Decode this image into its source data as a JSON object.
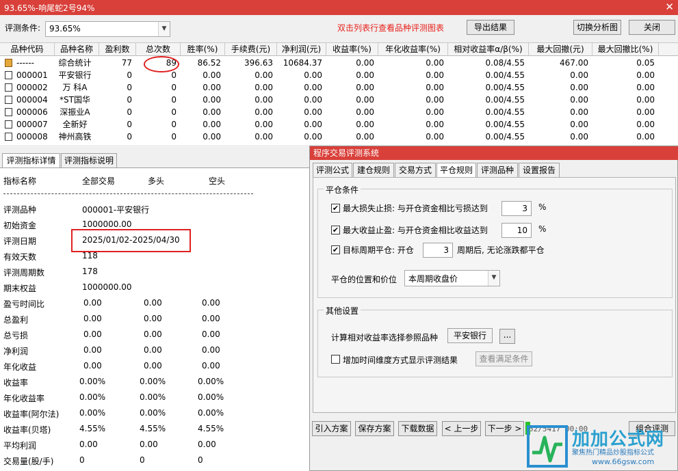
{
  "window": {
    "title": "93.65%-响尾蛇2号94%"
  },
  "toolbar": {
    "cond_label": "评测条件:",
    "cond_value": "93.65%",
    "hint": "双击列表行查看品种评测图表",
    "export_label": "导出结果",
    "switch_label": "切换分析图",
    "close_label": "关闭"
  },
  "grid": {
    "headers": [
      "品种代码",
      "品种名称",
      "盈利数",
      "总次数",
      "胜率(%)",
      "手续费(元)",
      "净利润(元)",
      "收益率(%)",
      "年化收益率(%)",
      "相对收益率α/β(%)",
      "最大回撤(元)",
      "最大回撤比(%)"
    ],
    "rows": [
      [
        "------",
        "综合统计",
        "77",
        "89",
        "86.52",
        "396.63",
        "10684.37",
        "0.00",
        "0.00",
        "0.08/4.55",
        "467.00",
        "0.05"
      ],
      [
        "000001",
        "平安银行",
        "0",
        "0",
        "0.00",
        "0.00",
        "0.00",
        "0.00",
        "0.00",
        "0.00/4.55",
        "0.00",
        "0.00"
      ],
      [
        "000002",
        "万 科A",
        "0",
        "0",
        "0.00",
        "0.00",
        "0.00",
        "0.00",
        "0.00",
        "0.00/4.55",
        "0.00",
        "0.00"
      ],
      [
        "000004",
        "*ST国华",
        "0",
        "0",
        "0.00",
        "0.00",
        "0.00",
        "0.00",
        "0.00",
        "0.00/4.55",
        "0.00",
        "0.00"
      ],
      [
        "000006",
        "深振业A",
        "0",
        "0",
        "0.00",
        "0.00",
        "0.00",
        "0.00",
        "0.00",
        "0.00/4.55",
        "0.00",
        "0.00"
      ],
      [
        "000007",
        "全新好",
        "0",
        "0",
        "0.00",
        "0.00",
        "0.00",
        "0.00",
        "0.00",
        "0.00/4.55",
        "0.00",
        "0.00"
      ],
      [
        "000008",
        "神州高铁",
        "0",
        "0",
        "0.00",
        "0.00",
        "0.00",
        "0.00",
        "0.00",
        "0.00/4.55",
        "0.00",
        "0.00"
      ]
    ]
  },
  "left": {
    "tabs": [
      "评测指标详情",
      "评测指标说明"
    ],
    "headers": [
      "指标名称",
      "全部交易",
      "多头",
      "空头"
    ],
    "rows": [
      {
        "k": "评测品种",
        "v": [
          "000001-平安银行"
        ]
      },
      {
        "k": "初始资金",
        "v": [
          "1000000.00"
        ]
      },
      {
        "k": "评测日期",
        "v": [
          "2025/01/02-2025/04/30"
        ]
      },
      {
        "k": "有效天数",
        "v": [
          "118"
        ]
      },
      {
        "k": "评测周期数",
        "v": [
          "178"
        ]
      },
      {
        "k": "期末权益",
        "v": [
          "1000000.00"
        ]
      },
      {
        "k": "盈亏时间比",
        "v": [
          "0.00",
          "0.00",
          "0.00"
        ]
      },
      {
        "k": "总盈利",
        "v": [
          "0.00",
          "0.00",
          "0.00"
        ]
      },
      {
        "k": "总亏损",
        "v": [
          "0.00",
          "0.00",
          "0.00"
        ]
      },
      {
        "k": "净利润",
        "v": [
          "0.00",
          "0.00",
          "0.00"
        ]
      },
      {
        "k": "年化收益",
        "v": [
          "0.00",
          "0.00",
          "0.00"
        ]
      },
      {
        "k": "收益率",
        "v": [
          "0.00%",
          "0.00%",
          "0.00%"
        ]
      },
      {
        "k": "年化收益率",
        "v": [
          "0.00%",
          "0.00%",
          "0.00%"
        ]
      },
      {
        "k": "收益率(阿尔法)",
        "v": [
          "0.00%",
          "0.00%",
          "0.00%"
        ]
      },
      {
        "k": "收益率(贝塔)",
        "v": [
          "4.55%",
          "4.55%",
          "4.55%"
        ]
      },
      {
        "k": "平均利润",
        "v": [
          "0.00",
          "0.00",
          "0.00"
        ]
      },
      {
        "k": "交易量(股/手)",
        "v": [
          "0",
          "0",
          "0"
        ]
      }
    ]
  },
  "dialog": {
    "title": "程序交易评测系统",
    "tabs": [
      "评测公式",
      "建仓规则",
      "交易方式",
      "平仓规则",
      "评测品种",
      "设置报告"
    ],
    "close_group": {
      "label": "平仓条件",
      "stoploss_label": "最大损失止损: 与开仓资金相比亏损达到",
      "stoploss_value": "3",
      "takeprofit_label": "最大收益止盈: 与开仓资金相比收益达到",
      "takeprofit_value": "10",
      "period_label": "目标周期平仓: 开仓",
      "period_value": "3",
      "period_suffix": "周期后, 无论涨跌都平仓",
      "pct": "%",
      "position_label": "平仓的位置和价位",
      "position_value": "本周期收盘价"
    },
    "other_group": {
      "label": "其他设置",
      "ref_label": "计算相对收益率选择参照品种",
      "ref_value": "平安银行",
      "ref_btn": "...",
      "time_dim_label": "增加时间维度方式显示评测结果",
      "view_cond_label": "查看满足条件"
    },
    "buttons": [
      "引入方案",
      "保存方案",
      "下载数据",
      "< 上一步",
      "下一步 >",
      "组合评测"
    ],
    "status": "52/5417  00:00"
  },
  "watermark": {
    "brand": "加加公式网",
    "sub": "聚焦热门精品炒股指标公式",
    "url": "www.66gsw.com"
  },
  "colors": {
    "titlebar": "#d9403a",
    "highlight": "#e02020",
    "hint": "#e8211b",
    "brand": "#2aa0cf"
  }
}
